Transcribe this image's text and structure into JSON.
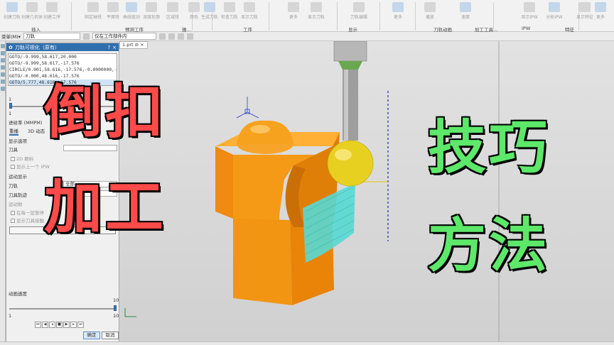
{
  "ribbon": {
    "buttons": [
      "创建刀轨",
      "创建几何体",
      "创建工序",
      "",
      "固定轴铣",
      "平面铣",
      "曲线驱动",
      "深度轮廓",
      "区域铣",
      "",
      "颜色",
      "",
      "生成刀轨",
      "检查刀轨",
      "显示刀轨",
      "",
      "更多",
      "显示刀轨",
      "",
      "刀轨编辑",
      "",
      "更多",
      "",
      "播放",
      "速度",
      "",
      "显示IPW",
      "分析IPW",
      "",
      "显示特征",
      "更多"
    ],
    "groups": [
      "插入",
      "预测工序",
      "操...",
      "工序",
      "显示",
      "刀轨动画",
      "加工工具...",
      "IPW",
      "特征"
    ]
  },
  "toolbar": {
    "menu_label": "菜单(M)▾",
    "filter_value": "刀轨",
    "scope_value": "仅在工作部件内"
  },
  "dialog": {
    "title": "刀轨可视化（原有）",
    "help": "?",
    "close": "×",
    "gcode_lines": [
      "GOTO/-9.999,58.617,20.000",
      "GOTO/-9.999,58.617,-17.576",
      "CIRCLE/0.001,58.616,-17.576,-0.0000000,-0.0",
      "GOTO/-0.000,48.616,-17.576",
      "GOTO/5.777,48.616,-17.576"
    ],
    "selected_line": 4,
    "slider_min": "1",
    "slider_max": "5",
    "feed_label": "进给率 (MMPM)",
    "tabs": [
      "重播",
      "3D 动态"
    ],
    "display_options": "显示选项",
    "tool_label": "刀具",
    "opt_2d": "2D 颗料",
    "opt_ipw": "显示上一个 IPW",
    "motion_display": "运动显示",
    "toolpath_label": "刀轨",
    "toolpath_value": "全部",
    "tool_trace_label": "刀具轨迹",
    "motion_count": "运动数",
    "opt_each_layer": "在每一层暂停",
    "opt_show_motion": "显示刀具接触",
    "anim_speed": "动画速度",
    "speed_min": "1",
    "speed_max": "10",
    "speed_value": "10",
    "ok_label": "确定",
    "cancel_label": "取消"
  },
  "viewport": {
    "tab_label": "1.prt ⊘ ×"
  },
  "overlay": {
    "left_line1": "倒扣",
    "left_line2": "加工",
    "right_line1": "技巧",
    "right_line2": "方法",
    "left_color": "#ff4a4a",
    "right_color": "#5de86a"
  },
  "colors": {
    "part": "#f59a16",
    "tool_ball": "#e8d020",
    "toolpath": "#4fd7d2",
    "title_bar": "#2f6fae"
  }
}
